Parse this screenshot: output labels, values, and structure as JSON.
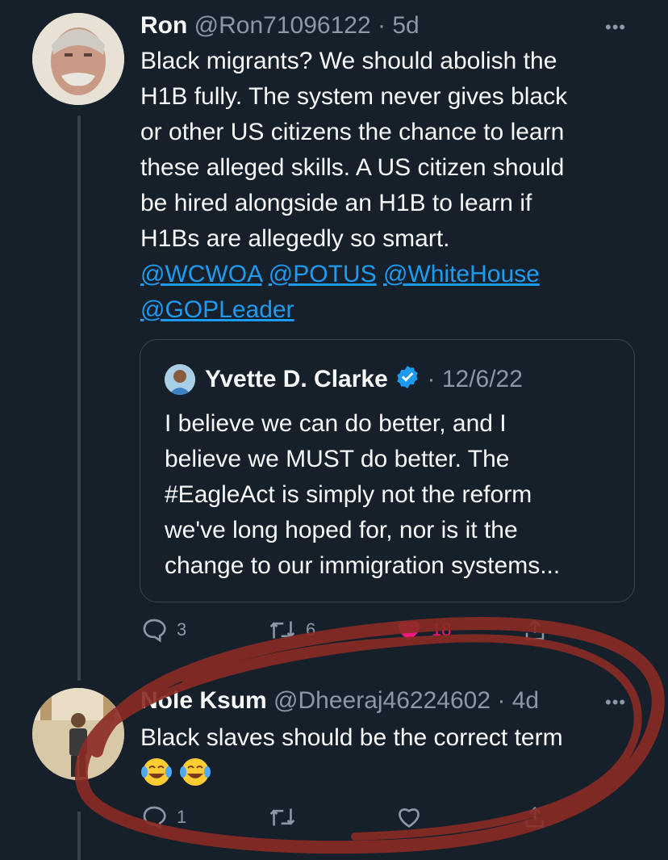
{
  "tweet1": {
    "name": "Ron",
    "handle": "@Ron71096122",
    "dot": "·",
    "time": "5d",
    "more": "•••",
    "lines": [
      "Black migrants?  We should abolish the",
      "H1B fully.  The system never gives black",
      "or other US citizens the chance to learn",
      "these alleged skills.  A US citizen should",
      "be hired alongside an H1B to learn if",
      "H1Bs are allegedly so smart."
    ],
    "mentions": [
      "@WCWOA",
      "@POTUS",
      "@WhiteHouse",
      "@GOPLeader"
    ],
    "quote": {
      "name": "Yvette D. Clarke",
      "dot": "·",
      "date": "12/6/22",
      "lines": [
        "I believe we can do better, and I",
        "believe we MUST do better. The",
        "#EagleAct is simply not the reform",
        "we've long hoped for, nor is it the",
        "change to our immigration systems..."
      ]
    },
    "actions": {
      "replies": "3",
      "retweets": "6",
      "likes": "18"
    },
    "colors": {
      "like": "#f91880",
      "link": "#1d9bf0",
      "background": "#15202b"
    }
  },
  "tweet2": {
    "name": "Nole Ksum",
    "handle": "@Dheeraj46224602",
    "dot": "·",
    "time": "4d",
    "more": "•••",
    "text": "Black slaves should be the correct term",
    "emoji": [
      "face-with-tears-of-joy",
      "face-with-tears-of-joy"
    ],
    "actions": {
      "replies": "1",
      "retweets": "",
      "likes": ""
    }
  },
  "annotation": {
    "color": "#8b2b25",
    "shape": "hand-drawn red circle around reply"
  }
}
